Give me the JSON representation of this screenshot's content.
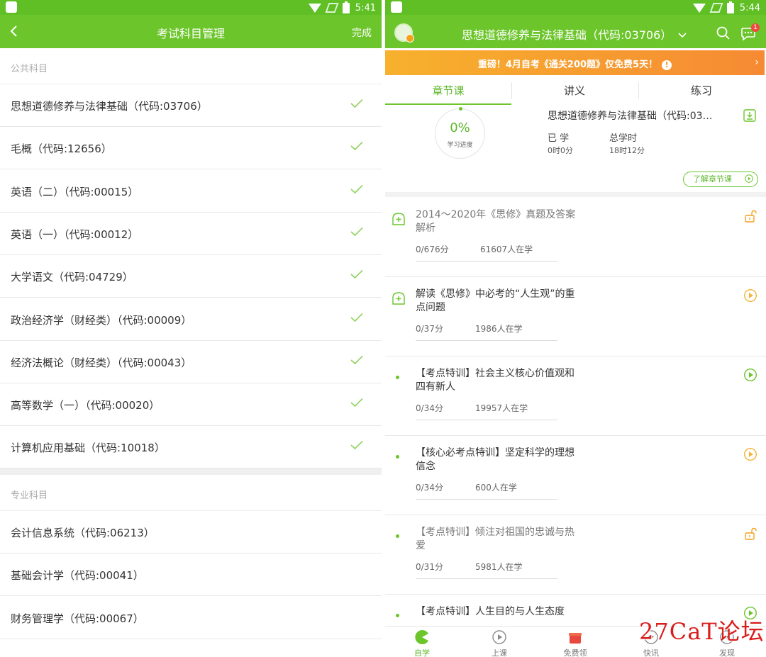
{
  "left": {
    "status": {
      "time": "5:41"
    },
    "nav": {
      "title": "考试科目管理",
      "done": "完成"
    },
    "public_section": {
      "header": "公共科目",
      "items": [
        {
          "label": "思想道德修养与法律基础（代码:03706）"
        },
        {
          "label": "毛概（代码:12656）"
        },
        {
          "label": "英语（二）（代码:00015）"
        },
        {
          "label": "英语（一）（代码:00012）"
        },
        {
          "label": "大学语文（代码:04729）"
        },
        {
          "label": "政治经济学（财经类）（代码:00009）"
        },
        {
          "label": "经济法概论（财经类）（代码:00043）"
        },
        {
          "label": "高等数学（一）（代码:00020）"
        },
        {
          "label": "计算机应用基础（代码:10018）"
        }
      ]
    },
    "major_section": {
      "header": "专业科目",
      "items": [
        {
          "label": "会计信息系统（代码:06213）"
        },
        {
          "label": "基础会计学（代码:00041）"
        },
        {
          "label": "财务管理学（代码:00067）"
        }
      ]
    }
  },
  "right": {
    "status": {
      "time": "5:44"
    },
    "header": {
      "course_title": "思想道德修养与法律基础（代码:03706）",
      "msg_badge": "1"
    },
    "banner": {
      "text": "重磅！4月自考《通关200题》仅免费5天！",
      "info": "!",
      "arrow": "›"
    },
    "tabs": [
      {
        "label": "章节课"
      },
      {
        "label": "讲义"
      },
      {
        "label": "练习"
      }
    ],
    "progress": {
      "percent": "0%",
      "label": "学习进度",
      "title": "思想道德修养与法律基础（代码:03…",
      "learned_label": "已 学",
      "learned_value": "0时0分",
      "total_label": "总学时",
      "total_value": "18时12分",
      "learn_button": "了解章节课"
    },
    "lessons": [
      {
        "title": "2014～2020年《思修》真题及答案解析",
        "score": "0/676分",
        "learners": "61607人在学",
        "marker": "plus",
        "action": "lock",
        "locked": true
      },
      {
        "title": "解读《思修》中必考的“人生观”的重点问题",
        "score": "0/37分",
        "learners": "1986人在学",
        "marker": "plus",
        "action": "play-orange",
        "locked": false
      },
      {
        "title": "【考点特训】社会主义核心价值观和四有新人",
        "score": "0/34分",
        "learners": "19957人在学",
        "marker": "dot",
        "action": "play-green",
        "locked": false
      },
      {
        "title": "【核心必考点特训】坚定科学的理想信念",
        "score": "0/34分",
        "learners": "600人在学",
        "marker": "dot",
        "action": "play-orange",
        "locked": false
      },
      {
        "title": "【考点特训】倾注对祖国的忠诚与热爱",
        "score": "0/31分",
        "learners": "5981人在学",
        "marker": "dot",
        "action": "lock",
        "locked": true
      },
      {
        "title": "【考点特训】人生目的与人生态度",
        "score": "",
        "learners": "",
        "marker": "dot",
        "action": "play-green",
        "locked": false
      }
    ],
    "bottom_nav": [
      {
        "label": "自学",
        "icon": "pacman-icon",
        "active": true
      },
      {
        "label": "上课",
        "icon": "play-circle-icon",
        "active": false
      },
      {
        "label": "免费领",
        "icon": "gift-icon",
        "active": false
      },
      {
        "label": "快讯",
        "icon": "news-icon",
        "active": false
      },
      {
        "label": "发现",
        "icon": "compass-icon",
        "active": false
      }
    ]
  },
  "watermark": "27CaT论坛",
  "colors": {
    "brand_green": "#6cc52b",
    "banner_orange": "#f7951f",
    "watermark_red": "#d91c1c"
  }
}
